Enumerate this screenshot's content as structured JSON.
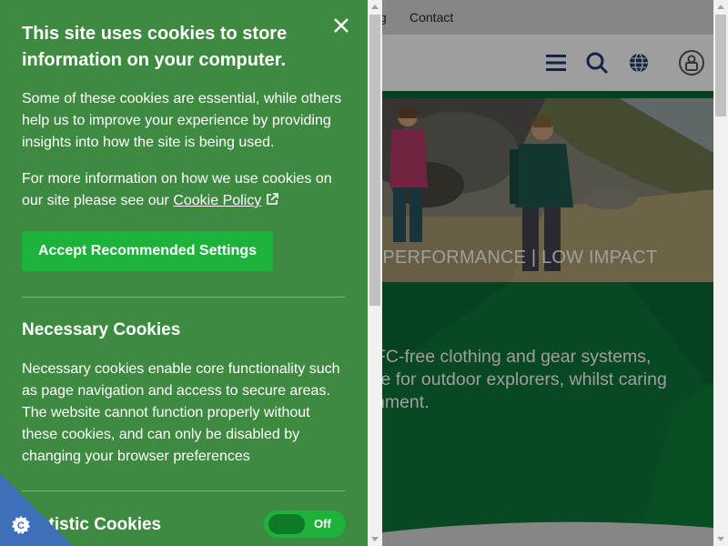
{
  "background": {
    "topbar_links": [
      "g",
      "Contact"
    ],
    "hero_tagline": "H PERFORMANCE  |  LOW IMPACT",
    "intro_lines": [
      "FC-free clothing and gear systems,",
      "re for outdoor explorers, whilst caring",
      "nment."
    ],
    "header_icons": [
      "menu-icon",
      "search-icon",
      "globe-icon",
      "account-icon"
    ],
    "colors": {
      "brand_green": "#0b6b33",
      "nav_blue": "#1f3b70"
    }
  },
  "cookie": {
    "title": "This site uses cookies to store information on your computer.",
    "para1": "Some of these cookies are essential, while others help us to improve your experience by providing insights into how the site is being used.",
    "para2_prefix": "For more information on how we use cookies on our site please see our ",
    "policy_link": "Cookie Policy",
    "accept_label": "Accept Recommended Settings",
    "necessary_heading": "Necessary Cookies",
    "necessary_text": "Necessary cookies enable core functionality such as page navigation and access to secure areas. The website cannot function properly without these cookies, and can only be disabled by changing your browser preferences",
    "statistic_heading": "Statistic Cookies",
    "statistic_toggle": "Off",
    "icons": [
      "close-icon",
      "external-link-icon",
      "cookie-icon"
    ],
    "colors": {
      "panel": "#3e8a40",
      "button": "#1db33a",
      "badge": "#3f6fba"
    }
  }
}
